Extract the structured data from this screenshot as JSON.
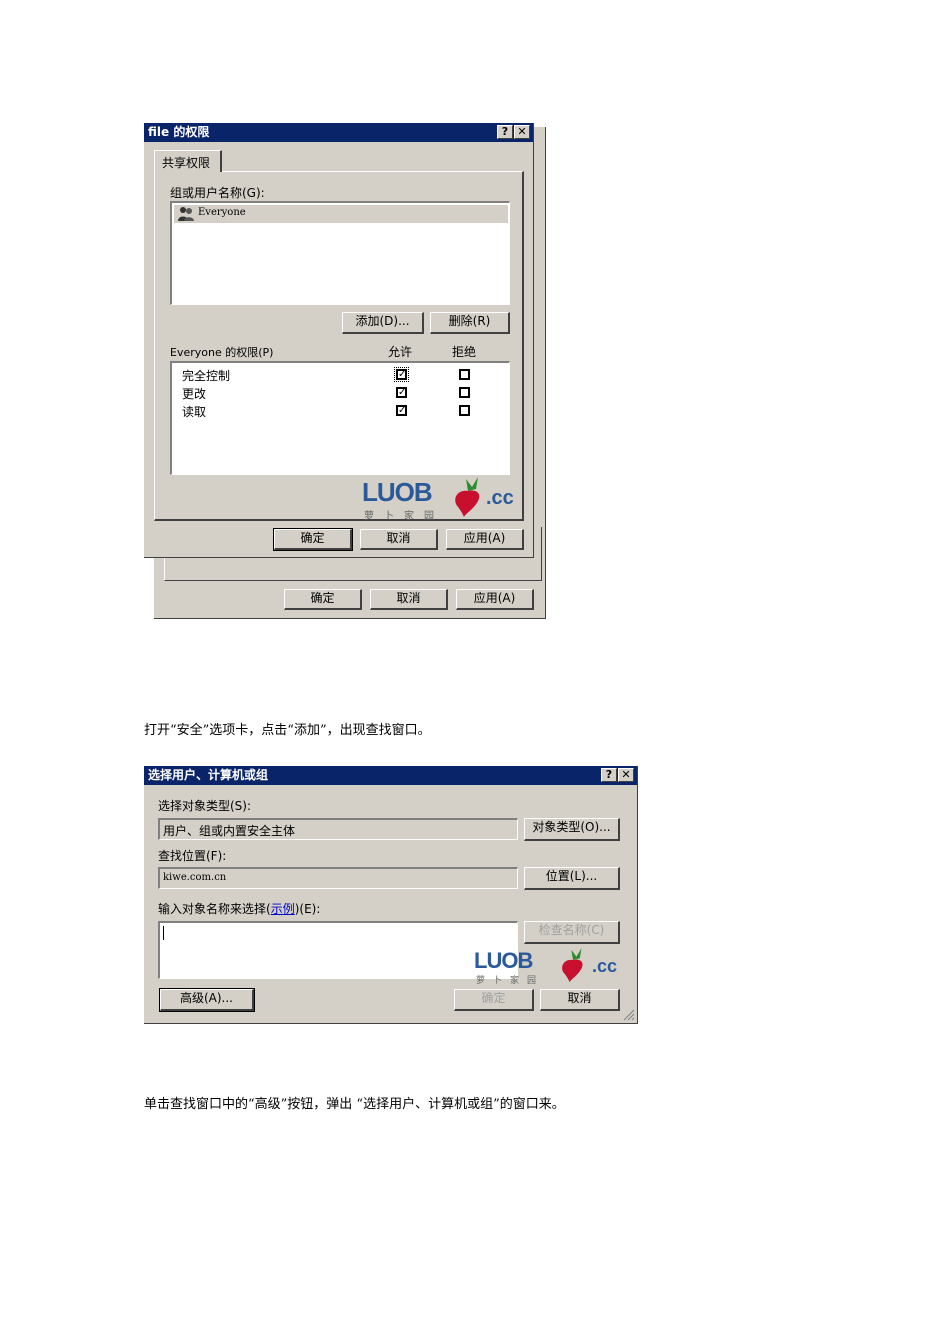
{
  "dialog1": {
    "title": "file 的权限",
    "help_btn": "?",
    "close_btn": "✕",
    "tab_label": "共享权限",
    "group_label": "组或用户名称(G):",
    "users": [
      "Everyone"
    ],
    "add_btn": "添加(D)...",
    "remove_btn": "删除(R)",
    "perms_label": "Everyone 的权限(P)",
    "allow_col": "允许",
    "deny_col": "拒绝",
    "permissions": [
      {
        "name": "完全控制",
        "allow": true,
        "deny": false
      },
      {
        "name": "更改",
        "allow": true,
        "deny": false
      },
      {
        "name": "读取",
        "allow": true,
        "deny": false
      }
    ],
    "ok_btn": "确定",
    "cancel_btn": "取消",
    "apply_btn": "应用(A)",
    "back_ok_btn": "确定",
    "back_cancel_btn": "取消",
    "back_apply_btn": "应用(A)"
  },
  "watermark": {
    "logo": "LUOB",
    "domain": ".cc",
    "chinese": "萝卜家园"
  },
  "paragraph1": "打开“安全”选项卡，点击“添加”，出现查找窗口。",
  "dialog2": {
    "title": "选择用户、计算机或组",
    "help_btn": "?",
    "close_btn": "✕",
    "object_type_label": "选择对象类型(S):",
    "object_type_value": "用户、组或内置安全主体",
    "object_type_btn": "对象类型(O)...",
    "location_label": "查找位置(F):",
    "location_value": "kiwe.com.cn",
    "location_btn": "位置(L)...",
    "enter_label_prefix": "输入对象名称来选择(",
    "enter_label_link": "示例",
    "enter_label_suffix": ")(E):",
    "check_names_btn": "检查名称(C)",
    "advanced_btn": "高级(A)...",
    "ok_btn": "确定",
    "cancel_btn": "取消"
  },
  "paragraph2": "单击查找窗口中的“高级”按钮，弹出 “选择用户、计算机或组”的窗口来。",
  "colors": {
    "titlebar": "#0a246a",
    "window": "#d4d0c8",
    "link": "#0000cc"
  }
}
